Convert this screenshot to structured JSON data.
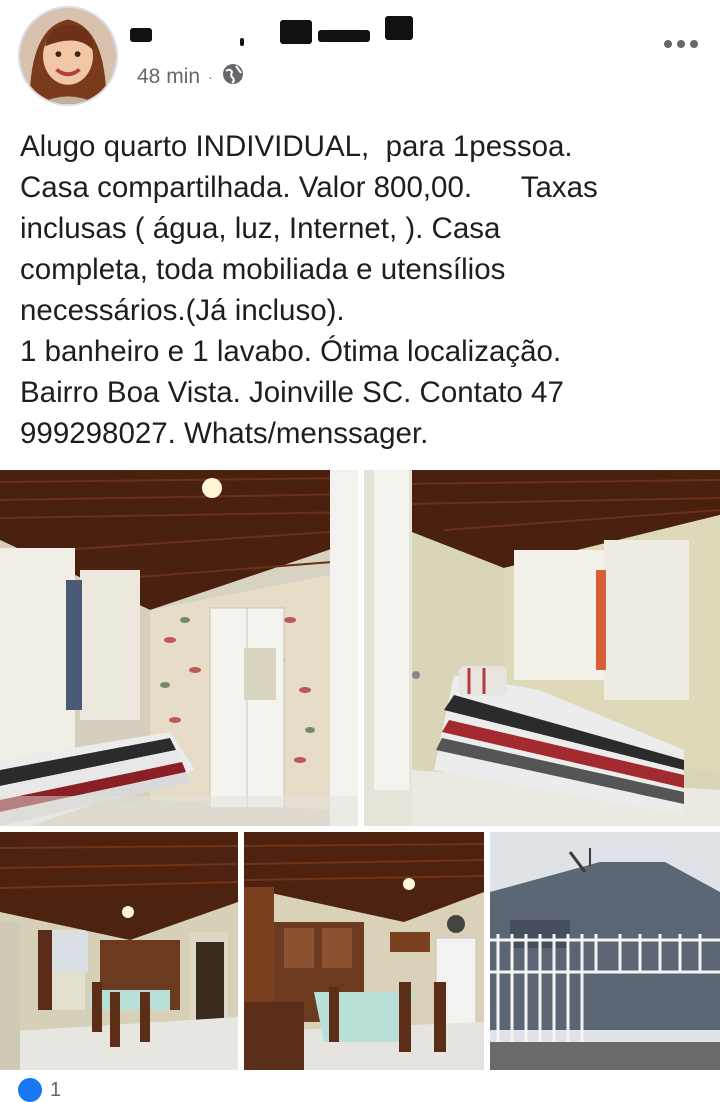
{
  "post": {
    "author_avatar_icon": "profile-photo",
    "time": "48 min",
    "separator": "·",
    "privacy_icon": "globe-icon",
    "more_icon": "more-options-icon",
    "text_lines": [
      "Alugo quarto INDIVIDUAL,  para 1pessoa.",
      "Casa compartilhada. Valor 800,00.      Taxas",
      "inclusas ( água, luz, Internet, ). Casa",
      "completa, toda mobiliada e utensílios",
      "necessários.(Já incluso).",
      "1 banheiro e 1 lavabo. Ótima localização.",
      "Bairro Boa Vista. Joinville SC. Contato 47",
      "999298027. Whats/menssager."
    ],
    "reaction_count": "1"
  },
  "colors": {
    "text": "#1c1e21",
    "meta": "#65676b",
    "like_blue": "#1877f2",
    "ceiling_wood": "#5a2a14"
  }
}
